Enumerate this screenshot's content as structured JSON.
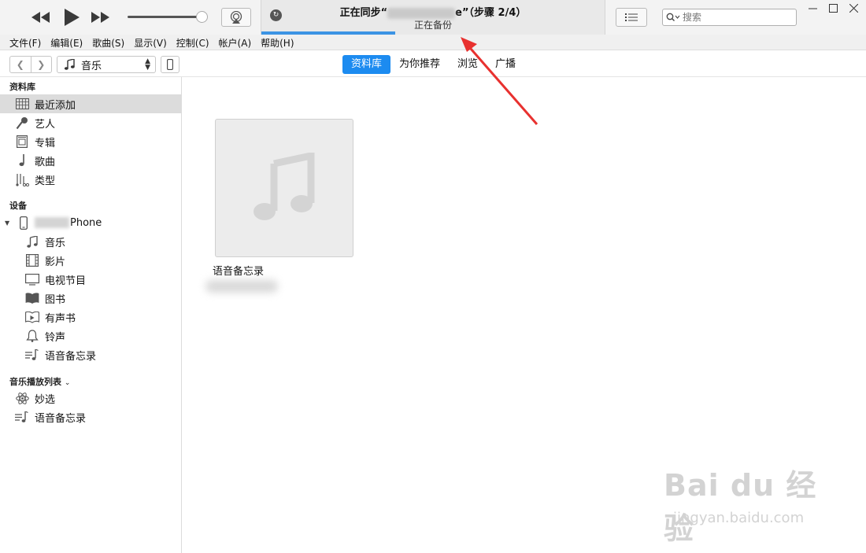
{
  "player": {
    "controls": [
      "rewind-icon",
      "play-icon",
      "fast-forward-icon"
    ],
    "volume": 0.8
  },
  "lcd": {
    "title_prefix": "正在同步“",
    "title_suffix": "e”（步骤 2/4）",
    "subtitle": "正在备份",
    "progress": 0.39
  },
  "search": {
    "placeholder": "搜索"
  },
  "menu": {
    "items": [
      "文件(F)",
      "编辑(E)",
      "歌曲(S)",
      "显示(V)",
      "控制(C)",
      "帐户(A)",
      "帮助(H)"
    ]
  },
  "nav": {
    "media_type": "音乐",
    "tabs": [
      "资料库",
      "为你推荐",
      "浏览",
      "广播"
    ],
    "active_tab": "资料库"
  },
  "sidebar": {
    "library_header": "资料库",
    "library": [
      {
        "label": "最近添加",
        "icon": "grid-icon",
        "selected": true
      },
      {
        "label": "艺人",
        "icon": "microphone-icon"
      },
      {
        "label": "专辑",
        "icon": "album-icon"
      },
      {
        "label": "歌曲",
        "icon": "music-note-icon"
      },
      {
        "label": "类型",
        "icon": "genre-icon"
      }
    ],
    "devices_header": "设备",
    "device_name_suffix": "Phone",
    "device_items": [
      {
        "label": "音乐",
        "icon": "music-note-icon"
      },
      {
        "label": "影片",
        "icon": "film-icon"
      },
      {
        "label": "电视节目",
        "icon": "tv-icon"
      },
      {
        "label": "图书",
        "icon": "book-icon"
      },
      {
        "label": "有声书",
        "icon": "audiobook-icon"
      },
      {
        "label": "铃声",
        "icon": "bell-icon"
      },
      {
        "label": "语音备忘录",
        "icon": "playlist-icon"
      }
    ],
    "playlists_header": "音乐播放列表",
    "playlists": [
      {
        "label": "妙选",
        "icon": "genius-icon"
      },
      {
        "label": "语音备忘录",
        "icon": "playlist-icon"
      }
    ]
  },
  "main": {
    "album_title": "语音备忘录"
  },
  "watermark": {
    "logo": "Bai du 经验",
    "url": "jingyan.baidu.com"
  }
}
